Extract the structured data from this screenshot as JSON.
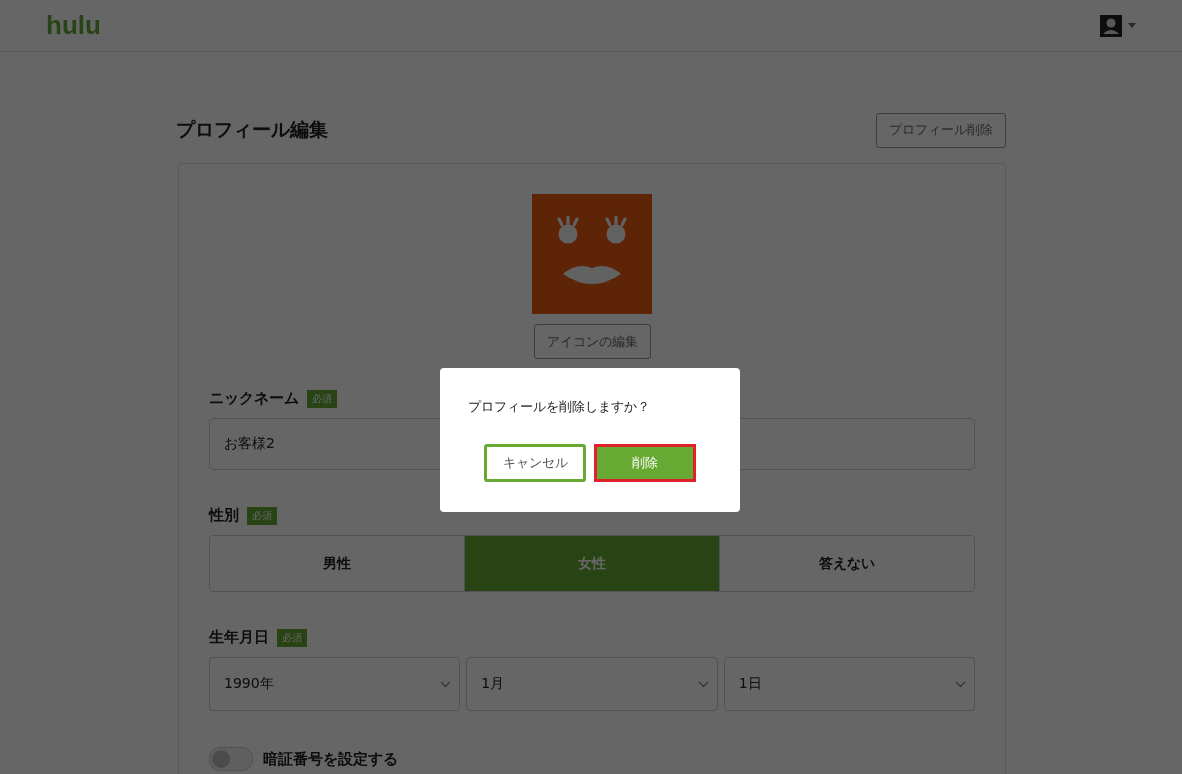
{
  "header": {
    "logo": "hulu"
  },
  "page": {
    "title": "プロフィール編集",
    "delete_button": "プロフィール削除",
    "icon_edit_button": "アイコンの編集",
    "nickname": {
      "label": "ニックネーム",
      "badge": "必須",
      "value": "お客様2"
    },
    "gender": {
      "label": "性別",
      "badge": "必須",
      "options": [
        {
          "label": "男性",
          "selected": false
        },
        {
          "label": "女性",
          "selected": true
        },
        {
          "label": "答えない",
          "selected": false
        }
      ]
    },
    "birthdate": {
      "label": "生年月日",
      "badge": "必須",
      "selects": [
        "1990年",
        "1月",
        "1日"
      ]
    },
    "pin": {
      "label": "暗証番号を設定する",
      "on": false
    }
  },
  "dialog": {
    "message": "プロフィールを削除しますか？",
    "buttons": [
      {
        "label": "キャンセル",
        "kind": "secondary",
        "highlighted": false
      },
      {
        "label": "削除",
        "kind": "primary",
        "highlighted": true
      }
    ]
  }
}
